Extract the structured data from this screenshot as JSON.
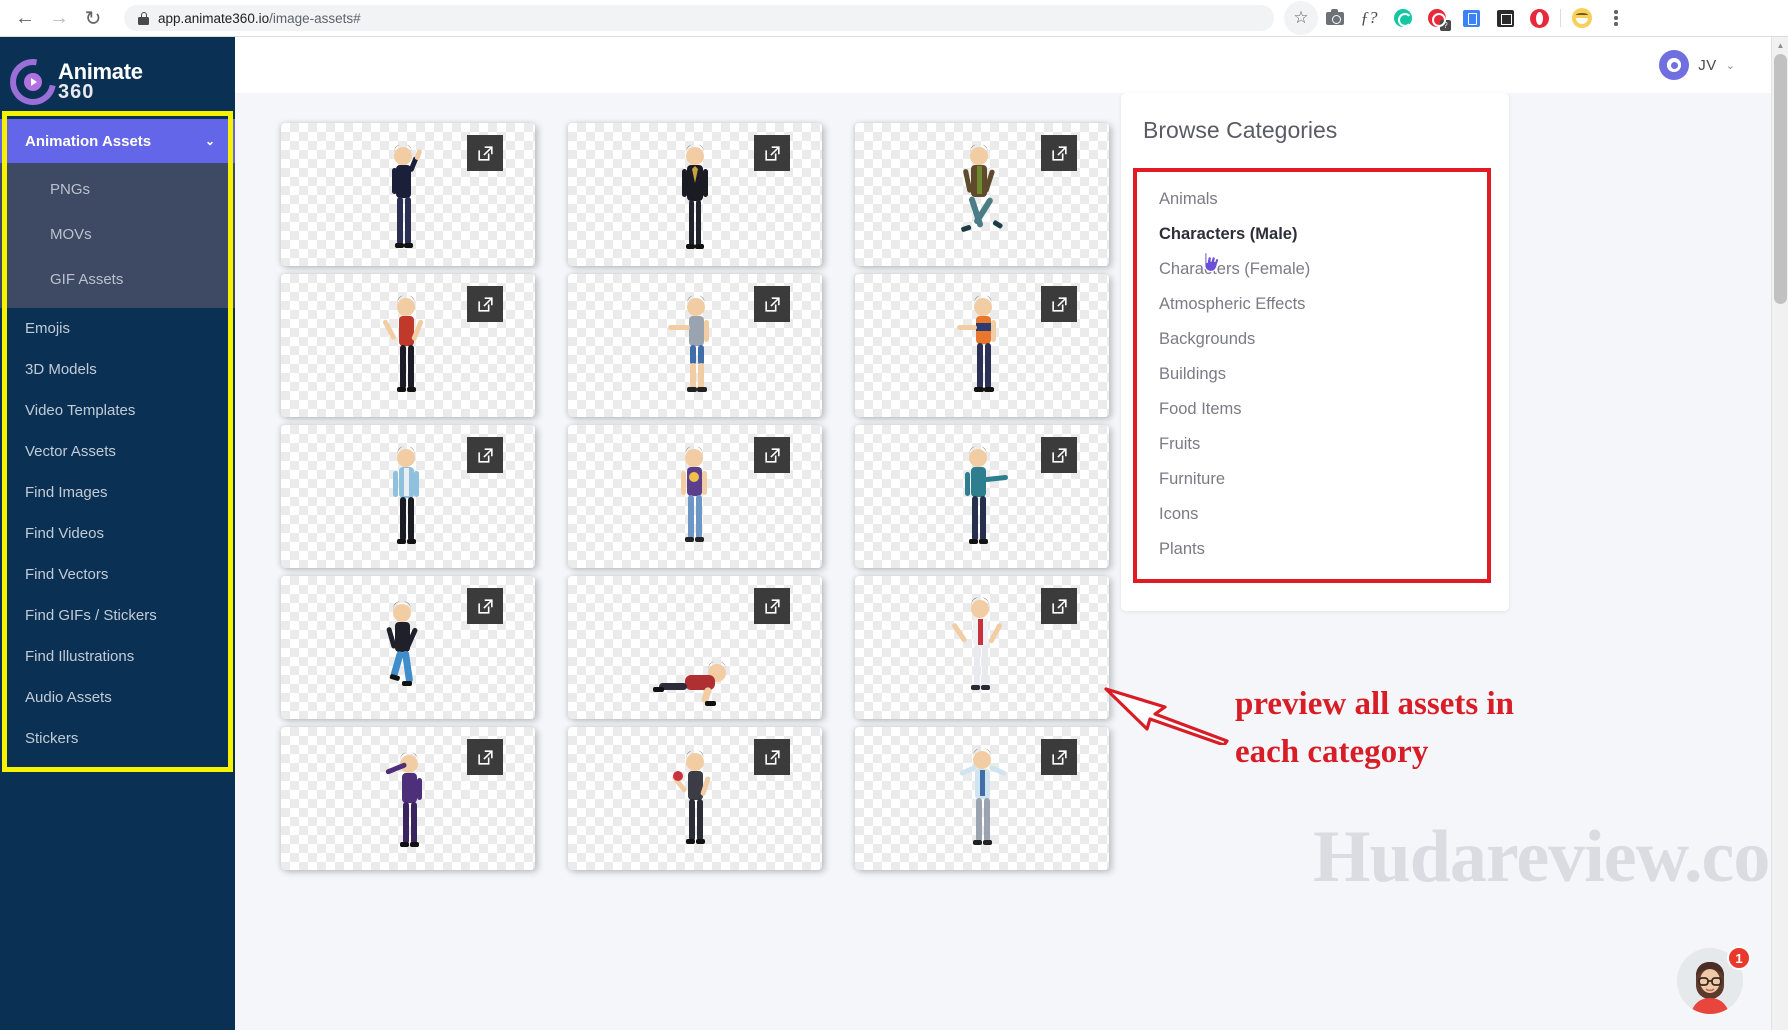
{
  "browser": {
    "url_host": "app.animate360.io",
    "url_path": "/image-assets#",
    "back_icon": "back-arrow-icon",
    "forward_icon": "forward-arrow-icon",
    "reload_icon": "reload-icon",
    "lock_icon": "lock-icon",
    "tools": [
      {
        "name": "bookmark-star-icon",
        "glyph": "☆"
      },
      {
        "name": "screenshot-camera-icon",
        "glyph": ""
      },
      {
        "name": "font-question-extension-icon",
        "glyph": "ƒ?"
      },
      {
        "name": "grammarly-extension-icon",
        "glyph": ""
      },
      {
        "name": "question-badge-extension-icon",
        "glyph": ""
      },
      {
        "name": "translate-extension-icon",
        "glyph": ""
      },
      {
        "name": "package-extension-icon",
        "glyph": ""
      },
      {
        "name": "opera-extension-icon",
        "glyph": ""
      },
      {
        "name": "profile-emoji-icon",
        "glyph": ""
      },
      {
        "name": "chrome-menu-kebab-icon",
        "glyph": "⋮"
      }
    ]
  },
  "sidebar": {
    "logo": {
      "line1": "Animate",
      "line2": "360",
      "mark": "animate360-logo-icon"
    },
    "active_item": {
      "label": "Animation Assets",
      "chevron": "⌄"
    },
    "submenu": [
      {
        "label": "PNGs"
      },
      {
        "label": "MOVs"
      },
      {
        "label": "GIF Assets"
      }
    ],
    "items": [
      {
        "label": "Emojis"
      },
      {
        "label": "3D Models"
      },
      {
        "label": "Video Templates"
      },
      {
        "label": "Vector Assets"
      },
      {
        "label": "Find Images"
      },
      {
        "label": "Find Videos"
      },
      {
        "label": "Find Vectors"
      },
      {
        "label": "Find GIFs / Stickers"
      },
      {
        "label": "Find Illustrations"
      },
      {
        "label": "Audio Assets"
      },
      {
        "label": "Stickers"
      }
    ],
    "highlight_color": "#f6f200",
    "background_color": "#0a3154",
    "active_color": "#6366e8"
  },
  "topbar": {
    "user_initials": "JV",
    "chevron": "⌄",
    "avatar_icon": "user-avatar-icon"
  },
  "assets": {
    "open_icon": "open-external-icon",
    "cards": [
      {
        "id": 1,
        "label": "asset-card-1"
      },
      {
        "id": 2,
        "label": "asset-card-2"
      },
      {
        "id": 3,
        "label": "asset-card-3"
      },
      {
        "id": 4,
        "label": "asset-card-4"
      },
      {
        "id": 5,
        "label": "asset-card-5"
      },
      {
        "id": 6,
        "label": "asset-card-6"
      },
      {
        "id": 7,
        "label": "asset-card-7"
      },
      {
        "id": 8,
        "label": "asset-card-8"
      },
      {
        "id": 9,
        "label": "asset-card-9"
      },
      {
        "id": 10,
        "label": "asset-card-10"
      },
      {
        "id": 11,
        "label": "asset-card-11"
      },
      {
        "id": 12,
        "label": "asset-card-12"
      },
      {
        "id": 13,
        "label": "asset-card-13"
      },
      {
        "id": 14,
        "label": "asset-card-14"
      },
      {
        "id": 15,
        "label": "asset-card-15"
      }
    ]
  },
  "categories_panel": {
    "title": "Browse Categories",
    "highlight_color": "#e01b24",
    "items": [
      {
        "label": "Animals",
        "selected": false
      },
      {
        "label": "Characters (Male)",
        "selected": true
      },
      {
        "label": "Characters (Female)",
        "selected": false
      },
      {
        "label": "Atmospheric Effects",
        "selected": false
      },
      {
        "label": "Backgrounds",
        "selected": false
      },
      {
        "label": "Buildings",
        "selected": false
      },
      {
        "label": "Food Items",
        "selected": false
      },
      {
        "label": "Fruits",
        "selected": false
      },
      {
        "label": "Furniture",
        "selected": false
      },
      {
        "label": "Icons",
        "selected": false
      },
      {
        "label": "Plants",
        "selected": false
      }
    ]
  },
  "annotation": {
    "line1": "preview all assets in",
    "line2": "each category",
    "color": "#d81d26",
    "arrow_icon": "annotation-arrow-icon"
  },
  "watermark": {
    "text": "Hudareview.com"
  },
  "chat_widget": {
    "badge_count": "1",
    "avatar_icon": "support-agent-avatar-icon"
  },
  "scrollbar": {
    "up_arrow": "▲"
  }
}
